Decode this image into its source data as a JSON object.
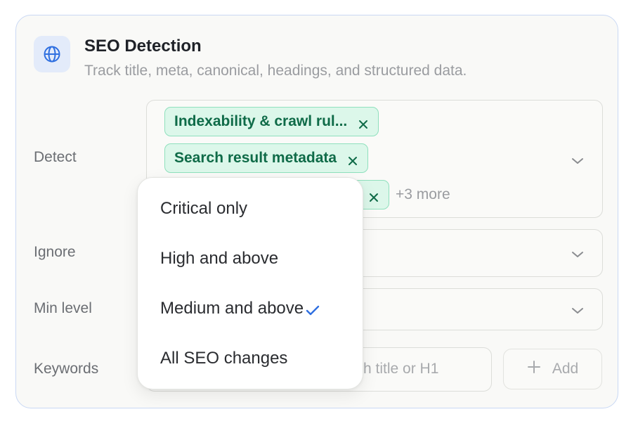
{
  "header": {
    "icon": "globe-icon",
    "title": "SEO Detection",
    "subtitle": "Track title, meta, canonical, headings, and structured data."
  },
  "detect": {
    "label": "Detect",
    "tags": [
      "Indexability & crawl rul...",
      "Search result metadata"
    ],
    "more": "+3 more"
  },
  "ignore": {
    "label": "Ignore"
  },
  "min_level": {
    "label": "Min level",
    "options": [
      "Critical only",
      "High and above",
      "Medium and above",
      "All SEO changes"
    ],
    "selected_index": 2
  },
  "keywords": {
    "label": "Keywords",
    "placeholder_visible": "h title or H1",
    "add_label": "Add"
  },
  "colors": {
    "accent": "#2f6fe0",
    "tag_text": "#0f6b48",
    "tag_bg": "#dcf7ea",
    "card_border": "#c9d8f4"
  }
}
